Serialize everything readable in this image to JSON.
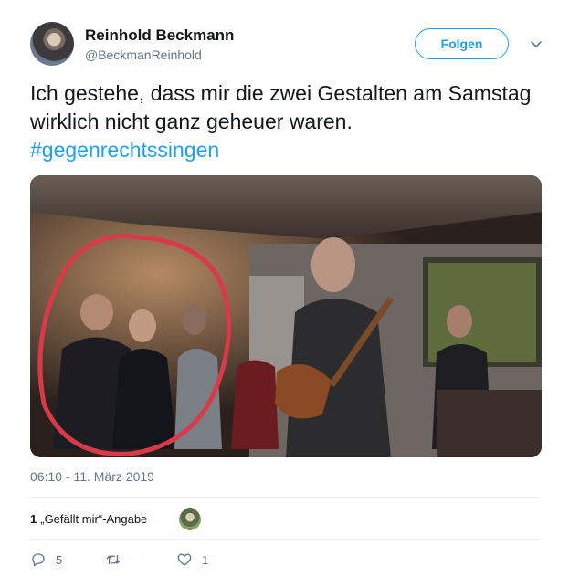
{
  "user": {
    "display_name": "Reinhold Beckmann",
    "handle": "@BeckmanReinhold"
  },
  "follow_button": {
    "label": "Folgen"
  },
  "tweet": {
    "text": "Ich gestehe, dass mir die zwei Gestalten am Samstag wirklich nicht ganz geheuer waren.",
    "hashtag": "#gegenrechtssingen",
    "timestamp": "06:10 - 11. März 2019"
  },
  "likes": {
    "count": "1",
    "label": "„Gefällt mir“-Angabe"
  },
  "actions": {
    "reply_count": "5",
    "retweet_count": "",
    "like_count": "1"
  },
  "icons": {
    "chevron": "chevron-down-icon",
    "reply": "reply-icon",
    "retweet": "retweet-icon",
    "like": "heart-icon"
  },
  "colors": {
    "accent": "#1da1f2",
    "secondary_text": "#657786",
    "annotation_circle": "#d83a4a"
  }
}
